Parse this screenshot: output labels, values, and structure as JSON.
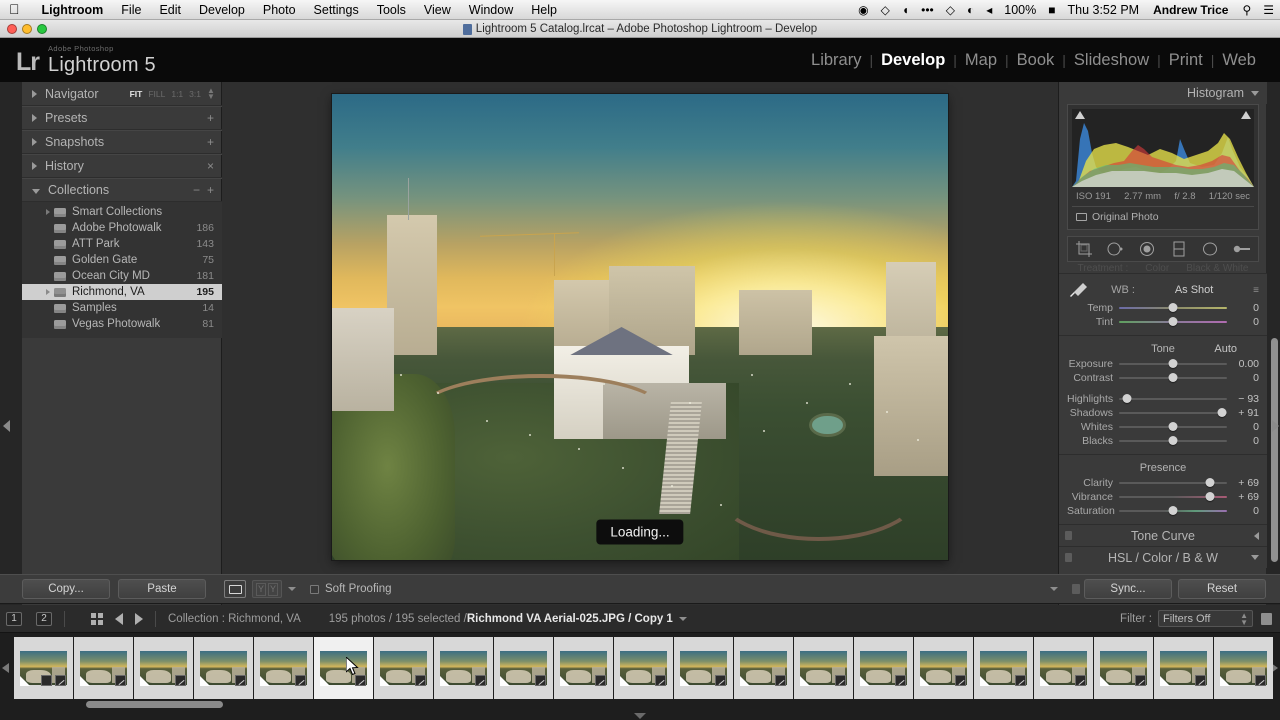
{
  "os_menu": {
    "apple_icon": "apple-icon",
    "items": [
      {
        "label": "Lightroom",
        "bold": true
      },
      {
        "label": "File",
        "bold": false
      },
      {
        "label": "Edit",
        "bold": false
      },
      {
        "label": "Develop",
        "bold": false
      },
      {
        "label": "Photo",
        "bold": false
      },
      {
        "label": "Settings",
        "bold": false
      },
      {
        "label": "Tools",
        "bold": false
      },
      {
        "label": "View",
        "bold": false
      },
      {
        "label": "Window",
        "bold": false
      },
      {
        "label": "Help",
        "bold": false
      }
    ],
    "status_items": [
      {
        "name": "record-icon",
        "glyph": "◉"
      },
      {
        "name": "dropbox-icon",
        "glyph": "⬡"
      },
      {
        "name": "cloud-sync-icon",
        "glyph": "◔"
      },
      {
        "name": "ellipsis-icon",
        "glyph": "•••"
      },
      {
        "name": "bluetooth-icon",
        "glyph": "⬡"
      },
      {
        "name": "wifi-icon",
        "glyph": "◠"
      },
      {
        "name": "volume-icon",
        "glyph": "◂"
      }
    ],
    "battery_percent": "100%",
    "battery_icon": "battery-icon",
    "clock": "Thu 3:52 PM",
    "user": "Andrew Trice",
    "search_icon": "search-icon",
    "notification_icon": "notification-center-icon"
  },
  "window": {
    "title": "Lightroom 5 Catalog.lrcat – Adobe Photoshop Lightroom – Develop",
    "doc_icon": "document-icon"
  },
  "branding": {
    "mark": "Lr",
    "suite": "Adobe Photoshop",
    "product": "Lightroom 5"
  },
  "modules": [
    {
      "label": "Library",
      "active": false
    },
    {
      "label": "Develop",
      "active": true
    },
    {
      "label": "Map",
      "active": false
    },
    {
      "label": "Book",
      "active": false
    },
    {
      "label": "Slideshow",
      "active": false
    },
    {
      "label": "Print",
      "active": false
    },
    {
      "label": "Web",
      "active": false
    }
  ],
  "left_panel": {
    "navigator": {
      "title": "Navigator",
      "zoom_levels": [
        {
          "label": "FIT",
          "active": true
        },
        {
          "label": "FILL",
          "active": false
        },
        {
          "label": "1:1",
          "active": false
        },
        {
          "label": "3:1",
          "active": false
        }
      ]
    },
    "presets": {
      "title": "Presets",
      "action": "+"
    },
    "snapshots": {
      "title": "Snapshots",
      "action": "+"
    },
    "history": {
      "title": "History",
      "action": "×"
    },
    "collections": {
      "title": "Collections",
      "minus": "−",
      "plus": "+",
      "items": [
        {
          "label": "Smart Collections",
          "count": "",
          "selected": false,
          "has_disclosure": true
        },
        {
          "label": "Adobe Photowalk",
          "count": "186",
          "selected": false,
          "has_disclosure": false
        },
        {
          "label": "ATT Park",
          "count": "143",
          "selected": false,
          "has_disclosure": false
        },
        {
          "label": "Golden Gate",
          "count": "75",
          "selected": false,
          "has_disclosure": false
        },
        {
          "label": "Ocean City MD",
          "count": "181",
          "selected": false,
          "has_disclosure": false
        },
        {
          "label": "Richmond, VA",
          "count": "195",
          "selected": true,
          "has_disclosure": true
        },
        {
          "label": "Samples",
          "count": "14",
          "selected": false,
          "has_disclosure": false
        },
        {
          "label": "Vegas Photowalk",
          "count": "81",
          "selected": false,
          "has_disclosure": false
        }
      ]
    }
  },
  "center": {
    "loading_label": "Loading..."
  },
  "right_panel": {
    "histogram": {
      "title": "Histogram",
      "iso": "ISO 191",
      "focal": "2.77 mm",
      "aperture": "f/ 2.8",
      "shutter": "1/120 sec",
      "original_photo": "Original Photo"
    },
    "tools": [
      {
        "name": "crop-overlay-icon"
      },
      {
        "name": "spot-removal-icon"
      },
      {
        "name": "red-eye-correction-icon"
      },
      {
        "name": "graduated-filter-icon"
      },
      {
        "name": "radial-filter-icon"
      },
      {
        "name": "adjustment-brush-icon"
      }
    ],
    "treatment": {
      "label": "Treatment :",
      "color": "Color",
      "bw": "Black & White"
    },
    "white_balance": {
      "eyedropper": "white-balance-selector-icon",
      "label": "WB :",
      "value": "As Shot",
      "menu_glyph": "≡",
      "sliders": [
        {
          "label": "Temp",
          "value": "0",
          "pos": 50,
          "style": "temp"
        },
        {
          "label": "Tint",
          "value": "0",
          "pos": 50,
          "style": "tint"
        }
      ]
    },
    "tone": {
      "label": "Tone",
      "auto": "Auto",
      "sliders": [
        {
          "label": "Exposure",
          "value": "0.00",
          "pos": 50,
          "style": ""
        },
        {
          "label": "Contrast",
          "value": "0",
          "pos": 50,
          "style": ""
        },
        {
          "label": "Highlights",
          "value": "− 93",
          "pos": 7,
          "style": ""
        },
        {
          "label": "Shadows",
          "value": "+ 91",
          "pos": 95,
          "style": ""
        },
        {
          "label": "Whites",
          "value": "0",
          "pos": 50,
          "style": ""
        },
        {
          "label": "Blacks",
          "value": "0",
          "pos": 50,
          "style": ""
        }
      ]
    },
    "presence": {
      "label": "Presence",
      "sliders": [
        {
          "label": "Clarity",
          "value": "+ 69",
          "pos": 84,
          "style": ""
        },
        {
          "label": "Vibrance",
          "value": "+ 69",
          "pos": 84,
          "style": "vib"
        },
        {
          "label": "Saturation",
          "value": "0",
          "pos": 50,
          "style": "sat"
        }
      ]
    },
    "collapsed_panels": [
      {
        "label": "Tone Curve",
        "arrow": "left"
      },
      {
        "label": "HSL / Color / B & W",
        "arrow": "down"
      }
    ]
  },
  "toolbar": {
    "copy_label": "Copy...",
    "paste_label": "Paste",
    "loupe_view_icon": "loupe-view-icon",
    "before_after_icon": "before-after-view-icon",
    "soft_proofing_label": "Soft Proofing",
    "sync_label": "Sync...",
    "reset_label": "Reset"
  },
  "filmstrip_bar": {
    "screen1": "1",
    "screen2": "2",
    "grid_icon": "grid-view-icon",
    "back_icon": "go-back-icon",
    "forward_icon": "go-forward-icon",
    "source": "Collection : Richmond, VA",
    "counts": "195 photos / 195 selected /",
    "filename": "Richmond VA Aerial-025.JPG / Copy 1",
    "filter_label": "Filter :",
    "filter_value": "Filters Off",
    "lock_icon": "filter-lock-icon"
  },
  "filmstrip": {
    "thumbnail_count": 21,
    "current_index": 5
  },
  "colors": {
    "panel_bg": "#3a3a3a",
    "canvas_bg": "#2f2f2f",
    "selection": "#cfcfcf",
    "text": "#b4b4b4",
    "accent": "#ffffff"
  }
}
